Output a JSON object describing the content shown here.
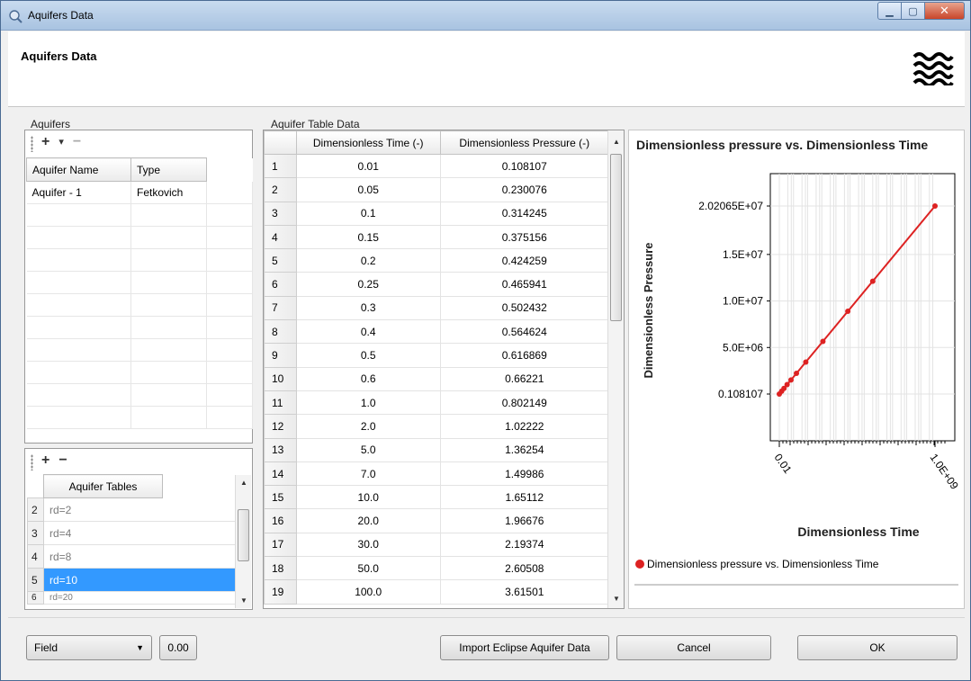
{
  "window": {
    "title": "Aquifers Data"
  },
  "header": {
    "title": "Aquifers Data"
  },
  "aquifers": {
    "group_label": "Aquifers",
    "add_label": "+",
    "dropdown_label": "▾",
    "remove_label": "−",
    "columns": [
      "Aquifer Name",
      "Type"
    ],
    "rows": [
      {
        "name": "Aquifer - 1",
        "type": "Fetkovich"
      }
    ]
  },
  "aquifer_tables": {
    "add_label": "+",
    "remove_label": "−",
    "column": "Aquifer Tables",
    "rows": [
      {
        "num": "2",
        "name": "rd=2",
        "selected": false
      },
      {
        "num": "3",
        "name": "rd=4",
        "selected": false
      },
      {
        "num": "4",
        "name": "rd=8",
        "selected": false
      },
      {
        "num": "5",
        "name": "rd=10",
        "selected": true
      },
      {
        "num": "6",
        "name": "rd=20",
        "selected": false
      }
    ]
  },
  "table_data": {
    "group_label": "Aquifer Table Data",
    "columns": [
      "Dimensionless Time (-)",
      "Dimensionless Pressure (-)"
    ],
    "rows": [
      [
        "1",
        "0.01",
        "0.108107"
      ],
      [
        "2",
        "0.05",
        "0.230076"
      ],
      [
        "3",
        "0.1",
        "0.314245"
      ],
      [
        "4",
        "0.15",
        "0.375156"
      ],
      [
        "5",
        "0.2",
        "0.424259"
      ],
      [
        "6",
        "0.25",
        "0.465941"
      ],
      [
        "7",
        "0.3",
        "0.502432"
      ],
      [
        "8",
        "0.4",
        "0.564624"
      ],
      [
        "9",
        "0.5",
        "0.616869"
      ],
      [
        "10",
        "0.6",
        "0.66221"
      ],
      [
        "11",
        "1.0",
        "0.802149"
      ],
      [
        "12",
        "2.0",
        "1.02222"
      ],
      [
        "13",
        "5.0",
        "1.36254"
      ],
      [
        "14",
        "7.0",
        "1.49986"
      ],
      [
        "15",
        "10.0",
        "1.65112"
      ],
      [
        "16",
        "20.0",
        "1.96676"
      ],
      [
        "17",
        "30.0",
        "2.19374"
      ],
      [
        "18",
        "50.0",
        "2.60508"
      ],
      [
        "19",
        "100.0",
        "3.61501"
      ]
    ]
  },
  "chart_data": {
    "type": "line",
    "title": "Dimensionless pressure vs. Dimensionless Time",
    "xlabel": "Dimensionless Time",
    "ylabel": "Dimensionless Pressure",
    "x_tick_labels": [
      "0.01",
      "1.0E+09"
    ],
    "y_tick_labels": [
      "2.02065E+07",
      "1.5E+07",
      "1.0E+07",
      "5.0E+06",
      "0.108107"
    ],
    "xlim": [
      0.01,
      1000000000.0
    ],
    "ylim": [
      0.108107,
      20206500.0
    ],
    "x_scale": "log",
    "y_scale": "linear",
    "grid": true,
    "legend_position": "bottom",
    "series": [
      {
        "name": "Dimensionless pressure vs. Dimensionless Time",
        "color": "#dd2222",
        "x": [
          0.01,
          1000000000.0
        ],
        "y": [
          0.108107,
          20206500.0
        ]
      }
    ]
  },
  "footer": {
    "unit_select_value": "Field",
    "numeric_value": "0.00",
    "import_label": "Import Eclipse Aquifer Data",
    "cancel_label": "Cancel",
    "ok_label": "OK"
  },
  "colors": {
    "accent": "#3399ff",
    "series": "#dd2222"
  }
}
